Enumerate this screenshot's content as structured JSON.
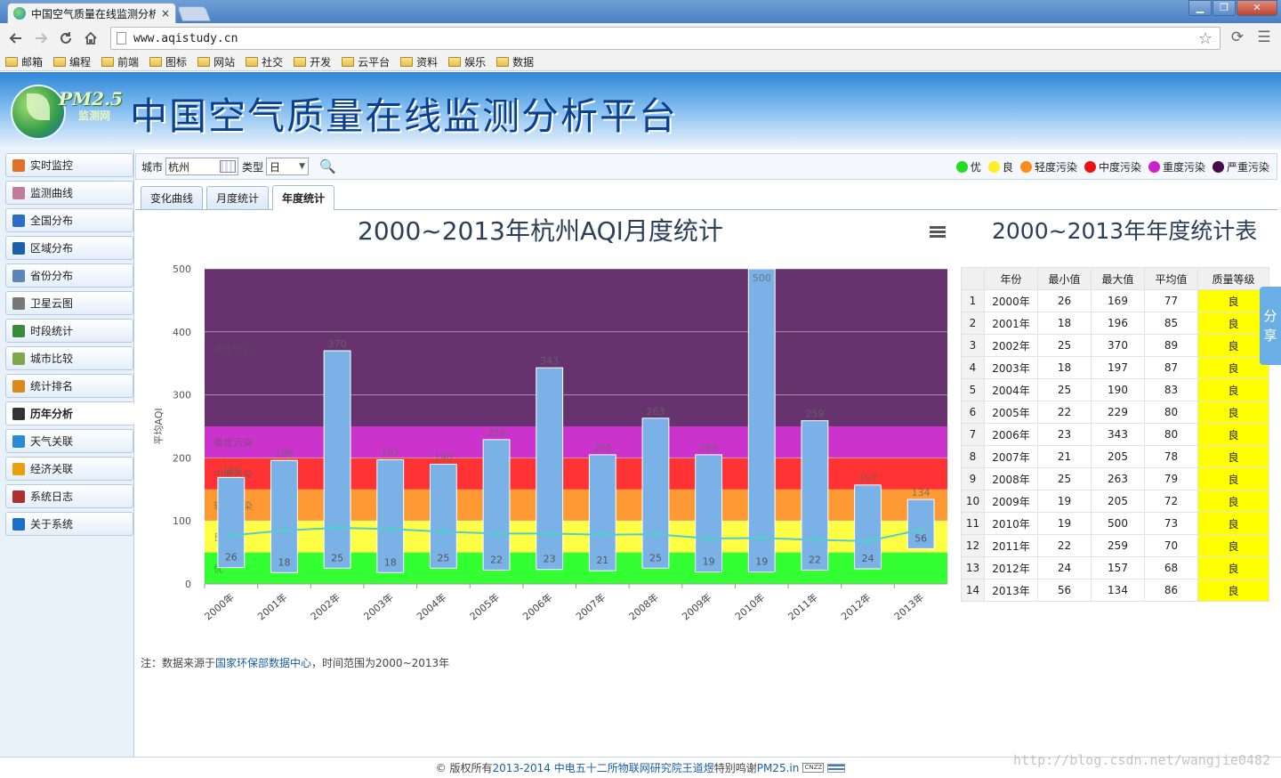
{
  "browser": {
    "tab_title": "中国空气质量在线监测分析",
    "tab_close": "×",
    "url": "www.aqistudy.cn",
    "window_min": "▁",
    "window_restore": "❐",
    "window_close": "✕",
    "bookmarks": [
      "邮箱",
      "编程",
      "前端",
      "图标",
      "网站",
      "社交",
      "开发",
      "云平台",
      "资料",
      "娱乐",
      "数据"
    ]
  },
  "site": {
    "logo_text": "PM2.5",
    "logo_sub": "监测网",
    "title": "中国空气质量在线监测分析平台"
  },
  "sidebar": {
    "items": [
      {
        "label": "实时监控",
        "icon": "monitor-icon",
        "color": "#e0702a"
      },
      {
        "label": "监测曲线",
        "icon": "curve-icon",
        "color": "#c07a9a"
      },
      {
        "label": "全国分布",
        "icon": "map-icon",
        "color": "#2a6ec8"
      },
      {
        "label": "区域分布",
        "icon": "region-icon",
        "color": "#1f5fa8"
      },
      {
        "label": "省份分布",
        "icon": "province-icon",
        "color": "#5d86b8"
      },
      {
        "label": "卫星云图",
        "icon": "satellite-icon",
        "color": "#777777"
      },
      {
        "label": "时段统计",
        "icon": "clock-icon",
        "color": "#3a8a3a"
      },
      {
        "label": "城市比较",
        "icon": "city-icon",
        "color": "#7aa84a"
      },
      {
        "label": "统计排名",
        "icon": "rank-icon",
        "color": "#d98a1a"
      },
      {
        "label": "历年分析",
        "icon": "history-icon",
        "color": "#333333"
      },
      {
        "label": "天气关联",
        "icon": "weather-icon",
        "color": "#2a8ad8"
      },
      {
        "label": "经济关联",
        "icon": "coin-icon",
        "color": "#e8a010"
      },
      {
        "label": "系统日志",
        "icon": "log-icon",
        "color": "#b03030"
      },
      {
        "label": "关于系统",
        "icon": "info-icon",
        "color": "#1f6ec8"
      }
    ],
    "active_index": 9
  },
  "filter": {
    "city_label": "城市",
    "city_value": "杭州",
    "type_label": "类型",
    "type_value": "日"
  },
  "legend": [
    {
      "label": "优",
      "color": "#22dd22"
    },
    {
      "label": "良",
      "color": "#ffee22"
    },
    {
      "label": "轻度污染",
      "color": "#ff8a1a"
    },
    {
      "label": "中度污染",
      "color": "#ee1111"
    },
    {
      "label": "重度污染",
      "color": "#cc22cc"
    },
    {
      "label": "严重污染",
      "color": "#4a0a4a"
    }
  ],
  "tabs": [
    "变化曲线",
    "月度统计",
    "年度统计"
  ],
  "active_tab": 2,
  "chart_data": {
    "type": "bar",
    "title": "2000~2013年杭州AQI月度统计",
    "ylabel": "平均AQI",
    "xlabel": "",
    "ylim": [
      0,
      500
    ],
    "yticks": [
      "0",
      "100",
      "200",
      "300",
      "400",
      "500"
    ],
    "categories": [
      "2000年",
      "2001年",
      "2002年",
      "2003年",
      "2004年",
      "2005年",
      "2006年",
      "2007年",
      "2008年",
      "2009年",
      "2010年",
      "2011年",
      "2012年",
      "2013年"
    ],
    "series": [
      {
        "type": "range",
        "min": [
          26,
          18,
          25,
          18,
          25,
          22,
          23,
          21,
          25,
          19,
          19,
          22,
          24,
          56
        ],
        "max": [
          169,
          196,
          370,
          197,
          190,
          229,
          343,
          205,
          263,
          205,
          500,
          259,
          157,
          134
        ],
        "color": "#7ab2e8"
      },
      {
        "type": "line",
        "values": [
          77,
          85,
          89,
          87,
          83,
          80,
          80,
          78,
          79,
          72,
          73,
          70,
          68,
          86
        ],
        "color": "#55cccc"
      }
    ],
    "bands": [
      {
        "label": "优",
        "from": 0,
        "to": 50,
        "color": "#33ff33"
      },
      {
        "label": "良",
        "from": 50,
        "to": 100,
        "color": "#ffff44"
      },
      {
        "label": "轻度污染",
        "from": 100,
        "to": 150,
        "color": "#ff9933"
      },
      {
        "label": "中度污染",
        "from": 150,
        "to": 200,
        "color": "#ff3333"
      },
      {
        "label": "重度污染",
        "from": 200,
        "to": 250,
        "color": "#cc33cc"
      },
      {
        "label": "严重污染",
        "from": 250,
        "to": 500,
        "color": "#66336e"
      }
    ],
    "grid": true
  },
  "table": {
    "title": "2000~2013年年度统计表",
    "headers": [
      "",
      "年份",
      "最小值",
      "最大值",
      "平均值",
      "质量等级"
    ],
    "rows": [
      [
        "1",
        "2000年",
        "26",
        "169",
        "77",
        "良"
      ],
      [
        "2",
        "2001年",
        "18",
        "196",
        "85",
        "良"
      ],
      [
        "3",
        "2002年",
        "25",
        "370",
        "89",
        "良"
      ],
      [
        "4",
        "2003年",
        "18",
        "197",
        "87",
        "良"
      ],
      [
        "5",
        "2004年",
        "25",
        "190",
        "83",
        "良"
      ],
      [
        "6",
        "2005年",
        "22",
        "229",
        "80",
        "良"
      ],
      [
        "7",
        "2006年",
        "23",
        "343",
        "80",
        "良"
      ],
      [
        "8",
        "2007年",
        "21",
        "205",
        "78",
        "良"
      ],
      [
        "9",
        "2008年",
        "25",
        "263",
        "79",
        "良"
      ],
      [
        "10",
        "2009年",
        "19",
        "205",
        "72",
        "良"
      ],
      [
        "11",
        "2010年",
        "19",
        "500",
        "73",
        "良"
      ],
      [
        "12",
        "2011年",
        "22",
        "259",
        "70",
        "良"
      ],
      [
        "13",
        "2012年",
        "24",
        "157",
        "68",
        "良"
      ],
      [
        "14",
        "2013年",
        "56",
        "134",
        "86",
        "良"
      ]
    ]
  },
  "share": [
    "分",
    "享"
  ],
  "note": {
    "prefix": "注：数据来源于",
    "link": "国家环保部数据中心",
    "suffix": "，时间范围为2000~2013年"
  },
  "footer": {
    "copyright": "© 版权所有 ",
    "years_org": "2013-2014 中电五十二所物联网研究院王道煜",
    "thanks": " 特别鸣谢 ",
    "thanks_link": "PM25.in",
    "cnzz": "CNZZ"
  },
  "watermark": "http://blog.csdn.net/wangjie0482"
}
